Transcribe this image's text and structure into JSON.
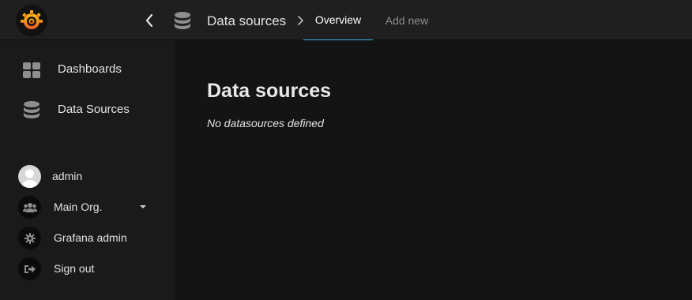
{
  "topnav": {
    "breadcrumb_title": "Data sources",
    "tabs": [
      {
        "label": "Overview",
        "active": true
      },
      {
        "label": "Add new",
        "active": false
      }
    ],
    "icons": {
      "logo": "grafana-logo-icon",
      "back": "chevron-left-icon",
      "section": "database-icon",
      "separator": "chevron-right-icon"
    }
  },
  "sidebar": {
    "items": [
      {
        "label": "Dashboards",
        "icon": "dashboard-grid-icon"
      },
      {
        "label": "Data Sources",
        "icon": "database-icon"
      }
    ],
    "user_menu": [
      {
        "label": "admin",
        "icon": "avatar"
      },
      {
        "label": "Main Org.",
        "icon": "users-icon"
      },
      {
        "label": "Grafana admin",
        "icon": "gear-icon"
      },
      {
        "label": "Sign out",
        "icon": "sign-out-icon"
      }
    ]
  },
  "main": {
    "title": "Data sources",
    "empty_message": "No datasources defined"
  },
  "colors": {
    "accent": "#33b5e5",
    "logo_orange": "#f05a28",
    "logo_yellow": "#fbca0a"
  }
}
